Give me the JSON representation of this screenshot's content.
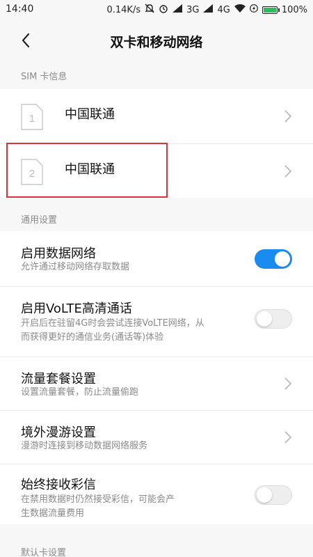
{
  "status_bar": {
    "time": "14:40",
    "speed": "0.14K/s",
    "network_3g": "3G",
    "network_4g": "4G",
    "battery": "100%"
  },
  "header": {
    "title": "双卡和移动网络",
    "back_icon": "chevron-left-icon"
  },
  "sim_section": {
    "label": "SIM 卡信息",
    "cards": [
      {
        "slot": "1",
        "carrier": "中国联通"
      },
      {
        "slot": "2",
        "carrier": "中国联通"
      }
    ]
  },
  "general_section": {
    "label": "通用设置",
    "items": [
      {
        "title": "启用数据网络",
        "subtitle": "允许通过移动网络存取数据",
        "control": "toggle",
        "on": true
      },
      {
        "title": "启用VoLTE高清通话",
        "subtitle_line1": "开启后在驻留4G时会尝试连接VoLTE网络，从",
        "subtitle_line2": "而获得更好的通信业务(通话等)体验",
        "control": "toggle",
        "on": false
      },
      {
        "title": "流量套餐设置",
        "subtitle": "设置流量套餐，防止流量偷跑",
        "control": "chevron"
      },
      {
        "title": "境外漫游设置",
        "subtitle": "漫游时连接到移动数据网络服务",
        "control": "chevron"
      },
      {
        "title": "始终接收彩信",
        "subtitle_line1": "在禁用数据时仍然接受彩信，可能会产",
        "subtitle_line2": "生数据流量费用",
        "control": "toggle",
        "on": false
      }
    ]
  },
  "default_section": {
    "label": "默认卡设置"
  },
  "colors": {
    "accent": "#1a8cf0",
    "highlight_box": "#e0303a",
    "battery_fill": "#2dbe60"
  }
}
